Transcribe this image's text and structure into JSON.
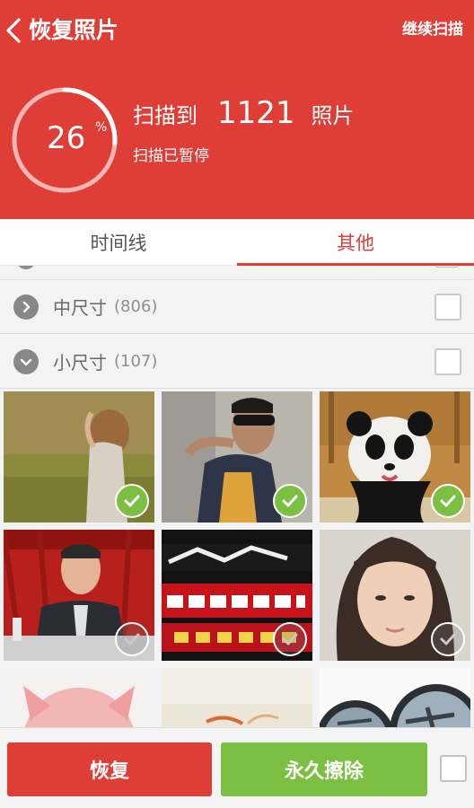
{
  "header": {
    "title": "恢复照片",
    "continue_label": "继续扫描",
    "progress_value": "26",
    "progress_unit": "%",
    "progress_fraction": 0.26,
    "scan_prefix": "扫描到",
    "scan_count": "1121",
    "scan_suffix": "照片",
    "scan_status": "扫描已暂停"
  },
  "tabs": [
    {
      "label": "时间线",
      "active": false
    },
    {
      "label": "其他",
      "active": true
    }
  ],
  "groups": [
    {
      "name": "中尺寸",
      "count": "(806)",
      "expanded": false,
      "checked": false
    },
    {
      "name": "小尺寸",
      "count": "(107)",
      "expanded": true,
      "checked": false
    }
  ],
  "photos": [
    {
      "subject": "woman-in-field",
      "checked": true
    },
    {
      "subject": "man-with-sunglasses",
      "checked": true
    },
    {
      "subject": "panda-cub",
      "checked": true
    },
    {
      "subject": "man-at-podium",
      "checked": false
    },
    {
      "subject": "red-text-banner",
      "checked": false
    },
    {
      "subject": "girl-portrait",
      "checked": false
    },
    {
      "subject": "pink-pig",
      "checked": false
    },
    {
      "subject": "pale-landscape",
      "checked": false
    },
    {
      "subject": "airplane-mirror",
      "checked": false
    }
  ],
  "footer": {
    "restore_label": "恢复",
    "erase_label": "永久擦除",
    "select_all_checked": false
  },
  "colors": {
    "primary": "#de3e36",
    "accent_green": "#7bc043"
  }
}
